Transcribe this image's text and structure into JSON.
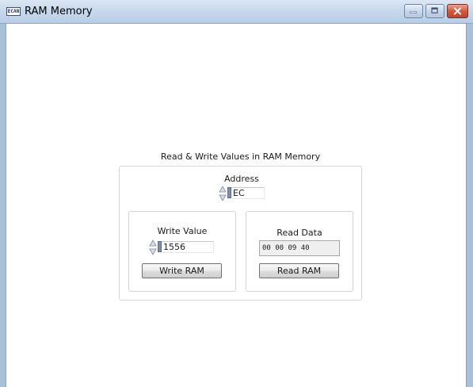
{
  "window": {
    "title": "RAM Memory",
    "icon_text": "ECAN",
    "controls": {
      "minimize_icon": "minimize-icon",
      "maximize_icon": "maximize-icon",
      "close_icon": "close-icon"
    }
  },
  "panel": {
    "title": "Read & Write Values in RAM Memory",
    "address": {
      "label": "Address",
      "value": "EC"
    },
    "write": {
      "label": "Write Value",
      "value": "1556",
      "button_label": "Write RAM"
    },
    "read": {
      "label": "Read Data",
      "value": "00 00 09 40",
      "button_label": "Read RAM"
    }
  },
  "colors": {
    "titlebar": "#c8d9ec",
    "close_button": "#d35a3f",
    "frame": "#a9c0d8"
  }
}
